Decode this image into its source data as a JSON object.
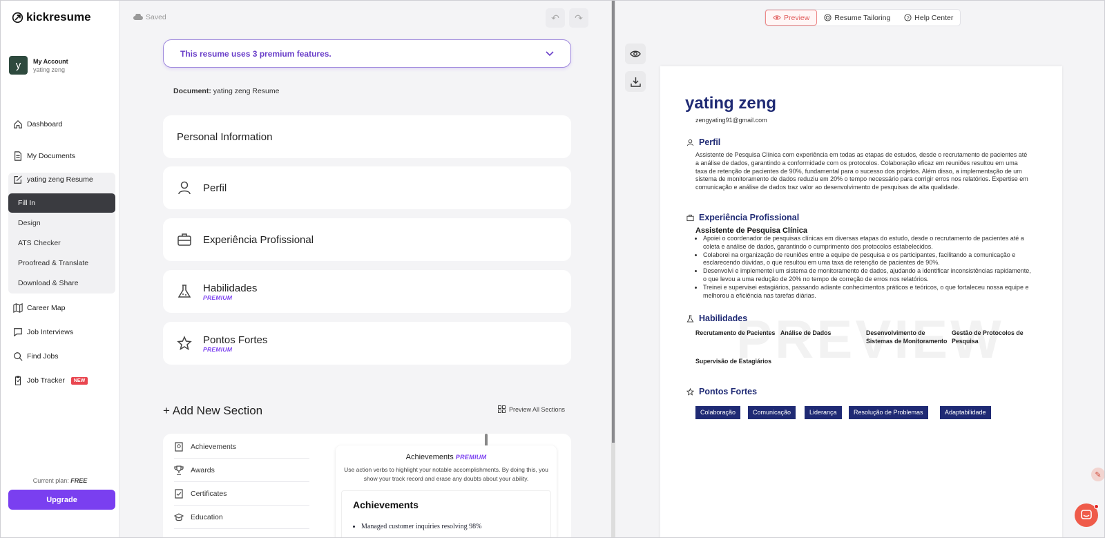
{
  "app": {
    "logo": "kickresume"
  },
  "account": {
    "initial": "y",
    "label": "My Account",
    "user": "yating zeng"
  },
  "sidebar": {
    "dashboard": "Dashboard",
    "my_documents": "My Documents",
    "current_doc": "yating zeng Resume",
    "sub": [
      "Fill In",
      "Design",
      "ATS Checker",
      "Proofread & Translate",
      "Download & Share"
    ],
    "career_map": "Career Map",
    "job_interviews": "Job Interviews",
    "find_jobs": "Find Jobs",
    "job_tracker": "Job Tracker",
    "new_badge": "NEW",
    "plan_label": "Current plan:",
    "plan_value": "FREE",
    "upgrade": "Upgrade"
  },
  "editor": {
    "saved": "Saved",
    "premium_banner": "This resume uses 3 premium features.",
    "doc_label": "Document:",
    "doc_name": "yating zeng Resume",
    "sections": [
      {
        "title": "Personal Information",
        "icon": "none"
      },
      {
        "title": "Perfil",
        "icon": "person-icon"
      },
      {
        "title": "Experiência Profissional",
        "icon": "briefcase-icon"
      },
      {
        "title": "Habilidades",
        "icon": "flask-icon",
        "tag": "PREMIUM"
      },
      {
        "title": "Pontos Fortes",
        "icon": "star-icon",
        "tag": "PREMIUM"
      }
    ],
    "add_section": "+ Add New Section",
    "preview_all": "Preview All Sections",
    "list": [
      "Achievements",
      "Awards",
      "Certificates",
      "Education"
    ],
    "ach_card": {
      "title": "Achievements",
      "tag": "PREMIUM",
      "desc": "Use action verbs to highlight your notable accomplishments. By doing this, you show your track record and erase any doubts about your ability.",
      "inner_title": "Achievements",
      "bullet": "Managed customer inquiries resolving 98%"
    }
  },
  "preview": {
    "tabs": [
      "Preview",
      "Resume Tailoring",
      "Help Center"
    ],
    "resume": {
      "name": "yating zeng",
      "email": "zengyating91@gmail.com",
      "perfil_head": "Perfil",
      "perfil_text": "Assistente de Pesquisa Clínica com experiência em todas as etapas de estudos, desde o recrutamento de pacientes até a análise de dados, garantindo a conformidade com os protocolos. Colaboração eficaz em reuniões resultou em uma taxa de retenção de pacientes de 90%, fundamental para o sucesso dos projetos. Além disso, a implementação de um sistema de monitoramento de dados reduziu em 20% o tempo necessário para corrigir erros nos relatórios. Expertise em comunicação e análise de dados traz valor ao desenvolvimento de pesquisas de alta qualidade.",
      "exp_head": "Experiência Profissional",
      "job_title": "Assistente de Pesquisa Clínica",
      "bullets": [
        "Apoiei o coordenador de pesquisas clínicas em diversas etapas do estudo, desde o recrutamento de pacientes até a coleta e análise de dados, garantindo o cumprimento dos protocolos estabelecidos.",
        "Colaborei na organização de reuniões entre a equipe de pesquisa e os participantes, facilitando a comunicação e esclarecendo dúvidas, o que resultou em uma taxa de retenção de pacientes de 90%.",
        "Desenvolvi e implementei um sistema de monitoramento de dados, ajudando a identificar inconsistências rapidamente, o que levou a uma redução de 20% no tempo de correção de erros nos relatórios.",
        "Treinei e supervisei estagiários, passando adiante conhecimentos práticos e teóricos, o que fortaleceu nossa equipe e melhorou a eficiência nas tarefas diárias."
      ],
      "skills_head": "Habilidades",
      "skills": [
        "Recrutamento de Pacientes",
        "Análise de Dados",
        "Desenvolvimento de Sistemas de Monitoramento",
        "Gestão de Protocolos de Pesquisa",
        "Supervisão de Estagiários"
      ],
      "strengths_head": "Pontos Fortes",
      "strengths": [
        "Colaboração",
        "Comunicação",
        "Liderança",
        "Resolução de Problemas",
        "Adaptabilidade"
      ],
      "watermark": "PREVIEW"
    }
  },
  "colors": {
    "accent": "#7a3ff0",
    "resume_navy": "#1f2a74",
    "preview_tab": "#e05a5a"
  }
}
